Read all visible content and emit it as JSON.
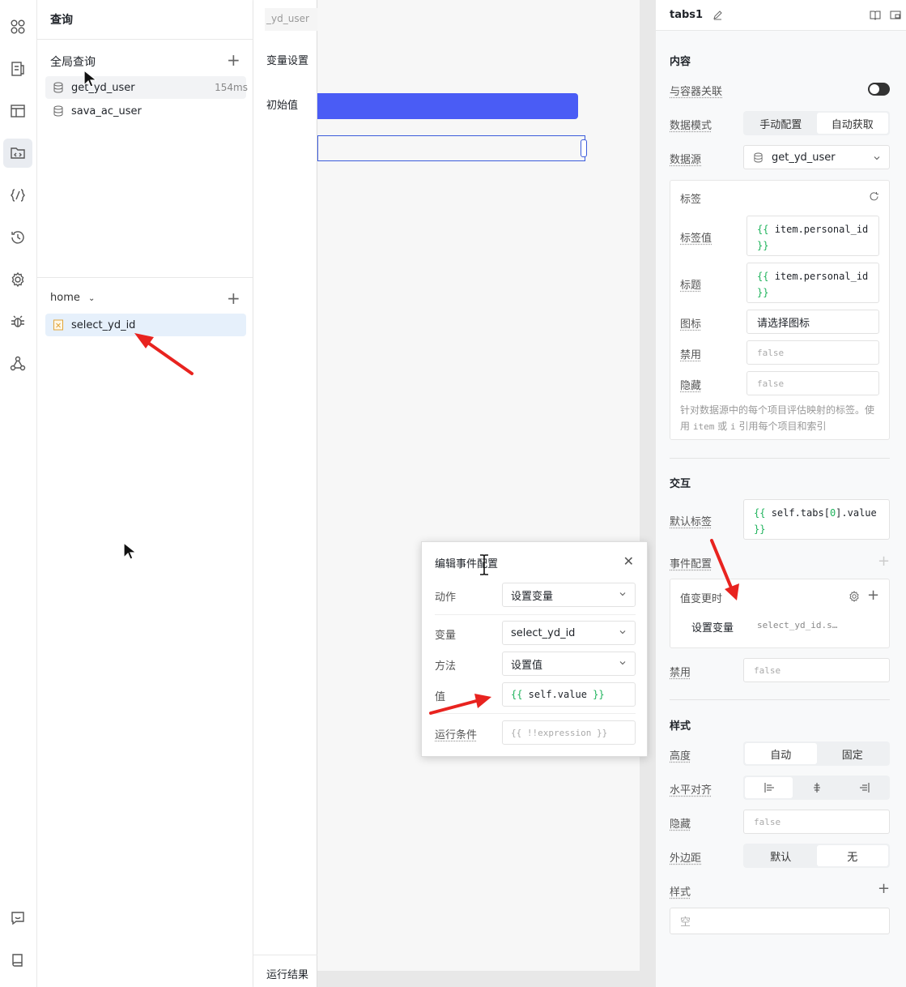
{
  "query_panel": {
    "title": "查询",
    "global_section": "全局查询",
    "global_queries": [
      {
        "name": "get_yd_user",
        "time": "154ms"
      },
      {
        "name": "sava_ac_user"
      }
    ],
    "page_section": "home",
    "page_variables": [
      {
        "name": "select_yd_id"
      }
    ]
  },
  "variable_panel": {
    "input_value": "_yd_user",
    "settings_label": "变量设置",
    "initial_label": "初始值",
    "result_label": "运行结果"
  },
  "event_dialog": {
    "title": "编辑事件配置",
    "action_label": "动作",
    "action_value": "设置变量",
    "variable_label": "变量",
    "variable_value": "select_yd_id",
    "method_label": "方法",
    "method_value": "设置值",
    "value_label": "值",
    "value_open": "{{",
    "value_expr": " self.value ",
    "value_close": "}}",
    "condition_label": "运行条件",
    "condition_placeholder": "{{ !!expression }}"
  },
  "props": {
    "component_name": "tabs1",
    "content": {
      "title": "内容",
      "container_label": "与容器关联",
      "mode_label": "数据模式",
      "mode_options": [
        "手动配置",
        "自动获取"
      ],
      "mode_selected": "自动获取",
      "source_label": "数据源",
      "source_value": "get_yd_user",
      "tag_card": {
        "title": "标签",
        "tag_value_label": "标签值",
        "tag_value_code": "item.personal_id",
        "caption_label": "标题",
        "caption_code": "item.personal_id",
        "icon_label": "图标",
        "icon_value": "请选择图标",
        "disabled_label": "禁用",
        "disabled_value": "false",
        "hidden_label": "隐藏",
        "hidden_value": "false",
        "hint_a": "针对数据源中的每个项目评估映射的标签。使用",
        "hint_item": "item",
        "hint_b": "或",
        "hint_i": "i",
        "hint_c": "引用每个项目和索引"
      }
    },
    "interaction": {
      "title": "交互",
      "default_tab_label": "默认标签",
      "default_tab_code_pre": "self.tabs[",
      "default_tab_code_num": "0",
      "default_tab_code_post": "].value",
      "event_config_label": "事件配置",
      "event_trigger": "值变更时",
      "event_action": "设置变量",
      "event_target": "select_yd_id.s…",
      "disabled_label": "禁用",
      "disabled_value": "false"
    },
    "style": {
      "title": "样式",
      "height_label": "高度",
      "height_options": [
        "自动",
        "固定"
      ],
      "height_selected": "自动",
      "align_label": "水平对齐",
      "hidden_label": "隐藏",
      "hidden_value": "false",
      "margin_label": "外边距",
      "margin_options": [
        "默认",
        "无"
      ],
      "margin_selected": "无",
      "style_label": "样式",
      "style_value": "空"
    }
  },
  "colors": {
    "accent": "#4a5cf5",
    "annotation_arrow": "#e8231f",
    "code_brace": "#1fb35c"
  }
}
